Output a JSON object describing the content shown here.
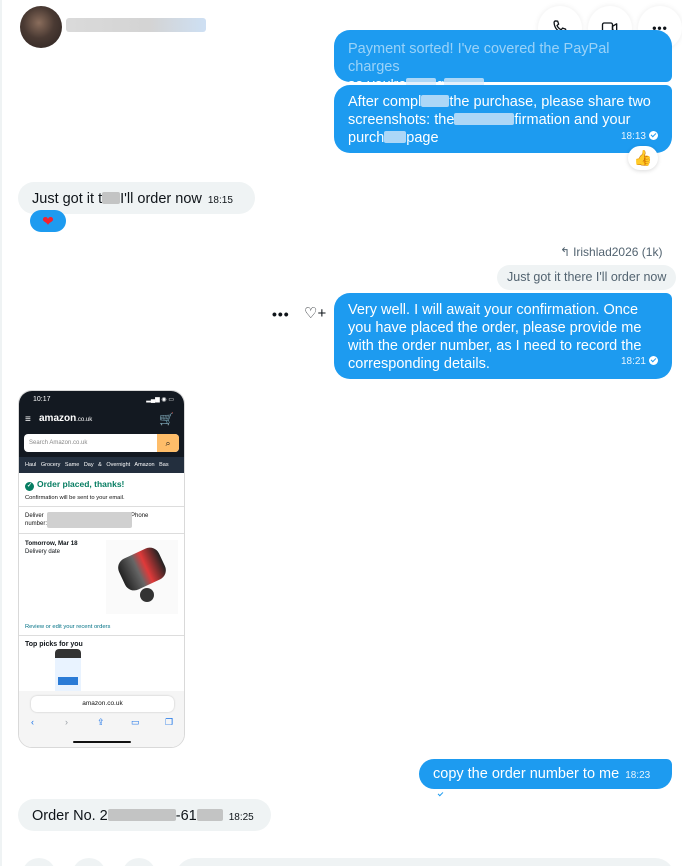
{
  "header": {
    "call_label": "",
    "video_label": "",
    "more_label": "•••"
  },
  "messages": {
    "m1": {
      "text_a": "Payment sorted! I've covered the PayPal charges",
      "text_b": "so you're",
      "text_c": "g"
    },
    "m2": {
      "text_a": "After compl",
      "text_b": "the purchase, please share two",
      "text_c": "screenshots: the",
      "text_d": "firmation and your",
      "text_e": "purch",
      "text_f": "page",
      "time": "18:13",
      "reaction": "👍"
    },
    "m3": {
      "text_a": "Just got it t",
      "text_b": "I'll order now",
      "time": "18:15",
      "reaction": "❤"
    },
    "reply": {
      "author": "Irishlad2026 (1k)",
      "quote": "Just got it there I'll order now"
    },
    "m4": {
      "text": "Very well. I will await your confirmation. Once you have placed the order, please provide me with the order number, as I need to record the corresponding details.",
      "time": "18:21",
      "dots": "•••",
      "react_icon": "♡+"
    },
    "m5": {
      "text": "copy the order number to me",
      "time": "18:23"
    },
    "m6": {
      "text_a": "Order No. 2",
      "text_b": "-61",
      "time": "18:25"
    }
  },
  "screenshot": {
    "status_time": "10:17",
    "status_icons": "▂▄▆ ◉ ▭",
    "logo": "amazon",
    "logo_suffix": ".co.uk",
    "search_placeholder": "Search Amazon.co.uk",
    "nav": "Haul  Grocery  Same Day & Overnight  Amazon Bas",
    "placed": "Order placed, thanks!",
    "confirmation": "Confirmation will be sent to your email.",
    "deliver_a": "Deliver",
    "deliver_b": ", Phone",
    "deliver_c": "number:",
    "date_bold": "Tomorrow, Mar 18",
    "date_sub": "Delivery date",
    "review": "Review or edit your recent orders",
    "picks": "Top picks for you",
    "url": "amazon.co.uk",
    "tool_back": "‹",
    "tool_fwd": "›",
    "tool_share": "⇪",
    "tool_book": "▭",
    "tool_tabs": "❐"
  },
  "colors": {
    "outgoing": "#1d9bf0",
    "incoming": "#eff3f4",
    "amazon_dark": "#131921",
    "amazon_success": "#067d62"
  }
}
